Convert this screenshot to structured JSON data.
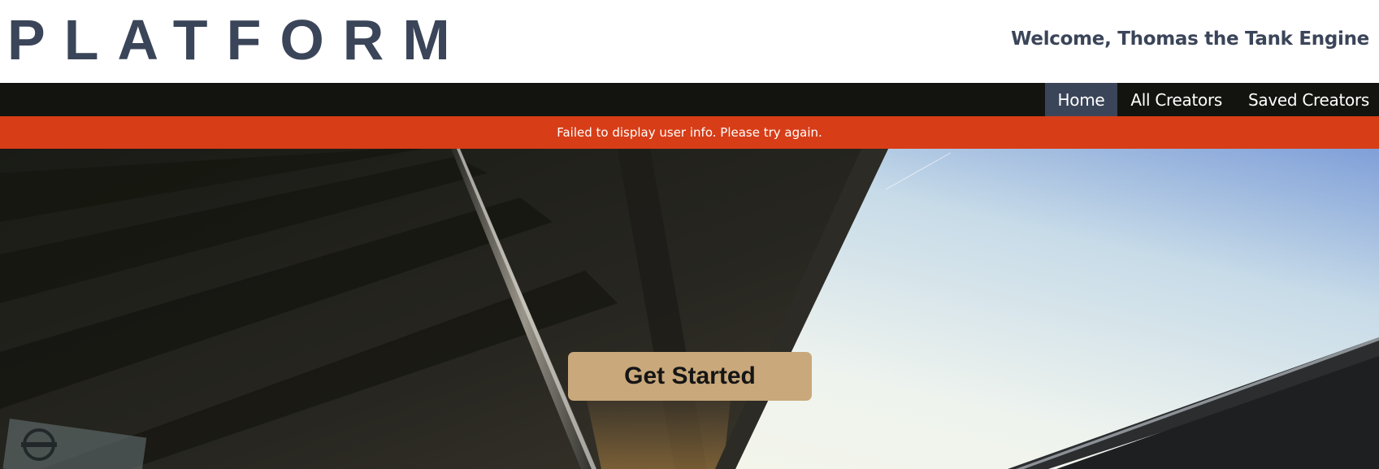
{
  "header": {
    "logo": "PLATFORM",
    "welcome": "Welcome, Thomas the Tank Engine"
  },
  "nav": {
    "items": [
      {
        "label": "Home",
        "active": true
      },
      {
        "label": "All Creators",
        "active": false
      },
      {
        "label": "Saved Creators",
        "active": false
      }
    ]
  },
  "alert": {
    "message": "Failed to display user info. Please try again."
  },
  "hero": {
    "image": "train-station-platform-canopy-photo",
    "cta_label": "Get Started"
  },
  "colors": {
    "brand_text": "#3b4559",
    "nav_bg": "#13140f",
    "nav_active_bg": "#3b4559",
    "alert_bg": "#d73d17",
    "cta_bg": "#c9a87b"
  }
}
